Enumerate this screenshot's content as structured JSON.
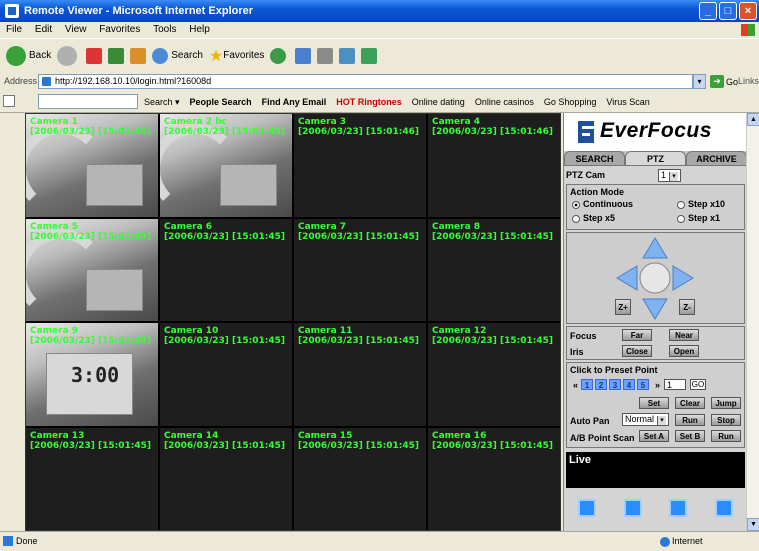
{
  "window": {
    "title": "Remote Viewer - Microsoft Internet Explorer"
  },
  "menu": [
    "File",
    "Edit",
    "View",
    "Favorites",
    "Tools",
    "Help"
  ],
  "toolbar": {
    "back": "Back",
    "search": "Search",
    "favorites": "Favorites"
  },
  "address": {
    "label": "Address",
    "url": "http://192.168.10.10/login.html?16008d",
    "go": "Go",
    "links": "Links"
  },
  "searchbar": {
    "search": "Search ▾",
    "items": [
      "People Search",
      "Find Any Email",
      "HOT Ringtones",
      "Online dating",
      "Online casinos",
      "Go Shopping",
      "Virus Scan"
    ]
  },
  "cameras": [
    {
      "name": "Camera 1",
      "ts": "[2006/03/23] [15:01:45]"
    },
    {
      "name": "Camera 2 bc",
      "ts": "[2006/03/23] [15:01:45]"
    },
    {
      "name": "Camera 3",
      "ts": "[2006/03/23] [15:01:46]"
    },
    {
      "name": "Camera 4",
      "ts": "[2006/03/23] [15:01:46]"
    },
    {
      "name": "Camera 5",
      "ts": "[2006/03/23] [15:01:45]"
    },
    {
      "name": "Camera 6",
      "ts": "[2006/03/23] [15:01:45]"
    },
    {
      "name": "Camera 7",
      "ts": "[2006/03/23] [15:01:45]"
    },
    {
      "name": "Camera 8",
      "ts": "[2006/03/23] [15:01:45]"
    },
    {
      "name": "Camera 9",
      "ts": "[2006/03/23] [15:01:45]",
      "digits": "3:00"
    },
    {
      "name": "Camera 10",
      "ts": "[2006/03/23] [15:01:45]"
    },
    {
      "name": "Camera 11",
      "ts": "[2006/03/23] [15:01:45]"
    },
    {
      "name": "Camera 12",
      "ts": "[2006/03/23] [15:01:45]"
    },
    {
      "name": "Camera 13",
      "ts": "[2006/03/23] [15:01:45]"
    },
    {
      "name": "Camera 14",
      "ts": "[2006/03/23] [15:01:45]"
    },
    {
      "name": "Camera 15",
      "ts": "[2006/03/23] [15:01:45]"
    },
    {
      "name": "Camera 16",
      "ts": "[2006/03/23] [15:01:45]"
    }
  ],
  "side": {
    "brand": "EverFocus",
    "tabs": [
      "SEARCH",
      "PTZ",
      "ARCHIVE"
    ],
    "ptz_cam_label": "PTZ Cam",
    "ptz_cam_value": "1",
    "action_mode_label": "Action Mode",
    "modes": [
      "Continuous",
      "Step x10",
      "Step x5",
      "Step x1"
    ],
    "zoom_in": "Z+",
    "zoom_out": "Z-",
    "focus_label": "Focus",
    "focus_far": "Far",
    "focus_near": "Near",
    "iris_label": "Iris",
    "iris_close": "Close",
    "iris_open": "Open",
    "preset_label": "Click to Preset Point",
    "preset_prev": "«",
    "preset_next": "»",
    "preset_numbers": [
      "1",
      "2",
      "3",
      "4",
      "5"
    ],
    "preset_value": "1",
    "preset_go": "GO",
    "set": "Set",
    "clear": "Clear",
    "jump": "Jump",
    "auto_pan_label": "Auto Pan",
    "auto_pan_value": "Normal",
    "run": "Run",
    "stop": "Stop",
    "ab_label": "A/B Point Scan",
    "set_a": "Set A",
    "set_b": "Set B",
    "ab_run": "Run",
    "live": "Live"
  },
  "status": {
    "text": "Done",
    "zone": "Internet"
  }
}
